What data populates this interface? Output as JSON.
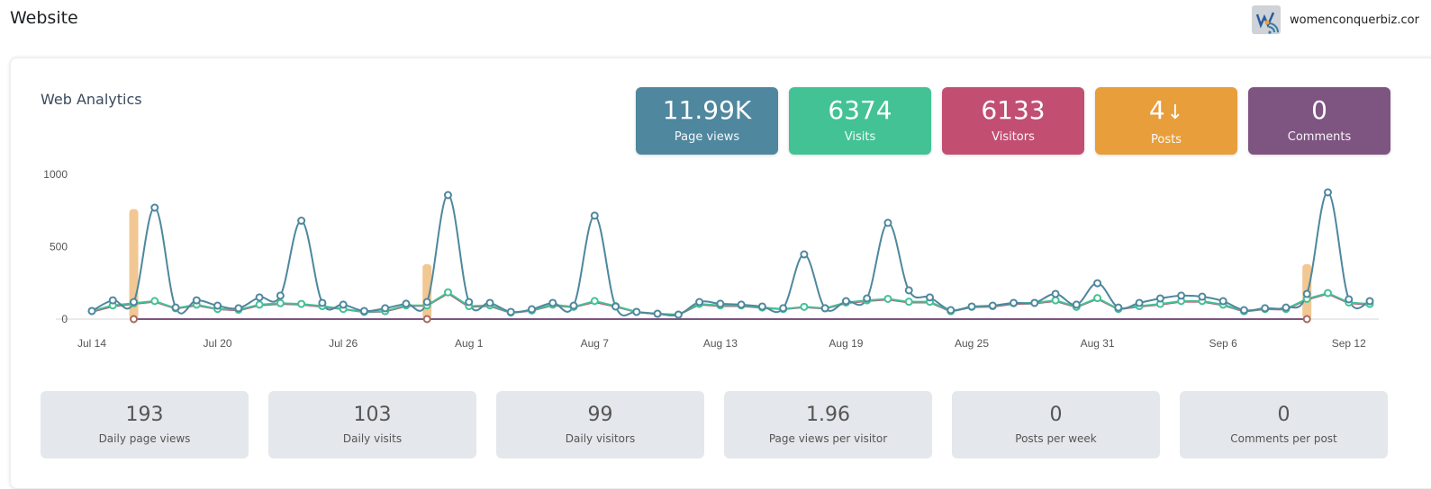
{
  "header": {
    "title": "Website",
    "site_name": "womenconquerbiz.cor",
    "site_logo_icon": "site-favicon-icon"
  },
  "card": {
    "title": "Web Analytics"
  },
  "tiles": [
    {
      "value": "11.99K",
      "label": "Page views",
      "color": "#4e879e"
    },
    {
      "value": "6374",
      "label": "Visits",
      "color": "#43c295"
    },
    {
      "value": "6133",
      "label": "Visitors",
      "color": "#c24f72"
    },
    {
      "value": "4",
      "arrow": "↓",
      "label": "Posts",
      "color": "#e79e3b"
    },
    {
      "value": "0",
      "label": "Comments",
      "color": "#7e5481"
    }
  ],
  "stats": [
    {
      "value": "193",
      "label": "Daily page views"
    },
    {
      "value": "103",
      "label": "Daily visits"
    },
    {
      "value": "99",
      "label": "Daily visitors"
    },
    {
      "value": "1.96",
      "label": "Page views per visitor"
    },
    {
      "value": "0",
      "label": "Posts per week"
    },
    {
      "value": "0",
      "label": "Comments per post"
    }
  ],
  "chart_data": {
    "type": "line",
    "title": "",
    "xlabel": "",
    "ylabel": "",
    "ylim": [
      0,
      1000
    ],
    "yticks": [
      0,
      500,
      1000
    ],
    "xtick_labels": [
      "Jul 14",
      "Jul 20",
      "Jul 26",
      "Aug 1",
      "Aug 7",
      "Aug 13",
      "Aug 19",
      "Aug 25",
      "Aug 31",
      "Sep 6",
      "Sep 12"
    ],
    "xtick_indices": [
      0,
      6,
      12,
      18,
      24,
      30,
      36,
      42,
      48,
      54,
      60
    ],
    "grid": false,
    "legend": "none",
    "x_start": "Jul 14",
    "x_end": "Sep 13",
    "series": [
      {
        "name": "Page views",
        "color": "#4e879e",
        "smooth": true,
        "values": [
          56,
          130,
          118,
          770,
          80,
          130,
          93,
          75,
          150,
          162,
          680,
          112,
          100,
          56,
          75,
          106,
          118,
          857,
          118,
          112,
          50,
          68,
          112,
          93,
          715,
          87,
          50,
          37,
          31,
          118,
          106,
          100,
          87,
          75,
          447,
          75,
          124,
          143,
          665,
          199,
          150,
          62,
          87,
          93,
          112,
          112,
          174,
          100,
          248,
          80,
          112,
          143,
          162,
          155,
          124,
          62,
          75,
          80,
          174,
          876,
          137,
          124
        ]
      },
      {
        "name": "Visits",
        "color": "#43c295",
        "values": [
          56,
          95,
          110,
          125,
          75,
          100,
          70,
          65,
          100,
          110,
          105,
          90,
          70,
          50,
          55,
          95,
          95,
          185,
          90,
          95,
          45,
          60,
          100,
          85,
          125,
          90,
          50,
          37,
          31,
          105,
          95,
          95,
          80,
          70,
          85,
          75,
          115,
          130,
          140,
          120,
          120,
          55,
          85,
          90,
          110,
          112,
          130,
          85,
          145,
          70,
          90,
          105,
          125,
          125,
          100,
          55,
          70,
          70,
          140,
          180,
          115,
          105
        ]
      },
      {
        "name": "Visitors",
        "color": "#c24f72",
        "values": [
          50,
          88,
          105,
          120,
          72,
          95,
          68,
          60,
          95,
          105,
          100,
          85,
          68,
          48,
          52,
          90,
          92,
          178,
          85,
          90,
          43,
          58,
          95,
          82,
          118,
          86,
          48,
          35,
          30,
          100,
          90,
          90,
          78,
          68,
          82,
          72,
          110,
          125,
          135,
          115,
          115,
          52,
          82,
          86,
          105,
          108,
          125,
          82,
          140,
          68,
          86,
          100,
          120,
          120,
          96,
          52,
          68,
          66,
          135,
          175,
          110,
          100
        ]
      },
      {
        "name": "Comments",
        "color": "#7e5481",
        "values": [
          0,
          0,
          0,
          0,
          0,
          0,
          0,
          0,
          0,
          0,
          0,
          0,
          0,
          0,
          0,
          0,
          0,
          0,
          0,
          0,
          0,
          0,
          0,
          0,
          0,
          0,
          0,
          0,
          0,
          0,
          0,
          0,
          0,
          0,
          0,
          0,
          0,
          0,
          0,
          0,
          0,
          0,
          0,
          0,
          0,
          0,
          0,
          0,
          0,
          0,
          0,
          0,
          0,
          0,
          0,
          0,
          0,
          0,
          0,
          0,
          0,
          0
        ]
      },
      {
        "name": "Posts",
        "color": "#f0c48e",
        "type": "bar",
        "points": [
          {
            "index": 2,
            "value": 2
          },
          {
            "index": 16,
            "value": 1
          },
          {
            "index": 58,
            "value": 1
          }
        ]
      }
    ]
  }
}
